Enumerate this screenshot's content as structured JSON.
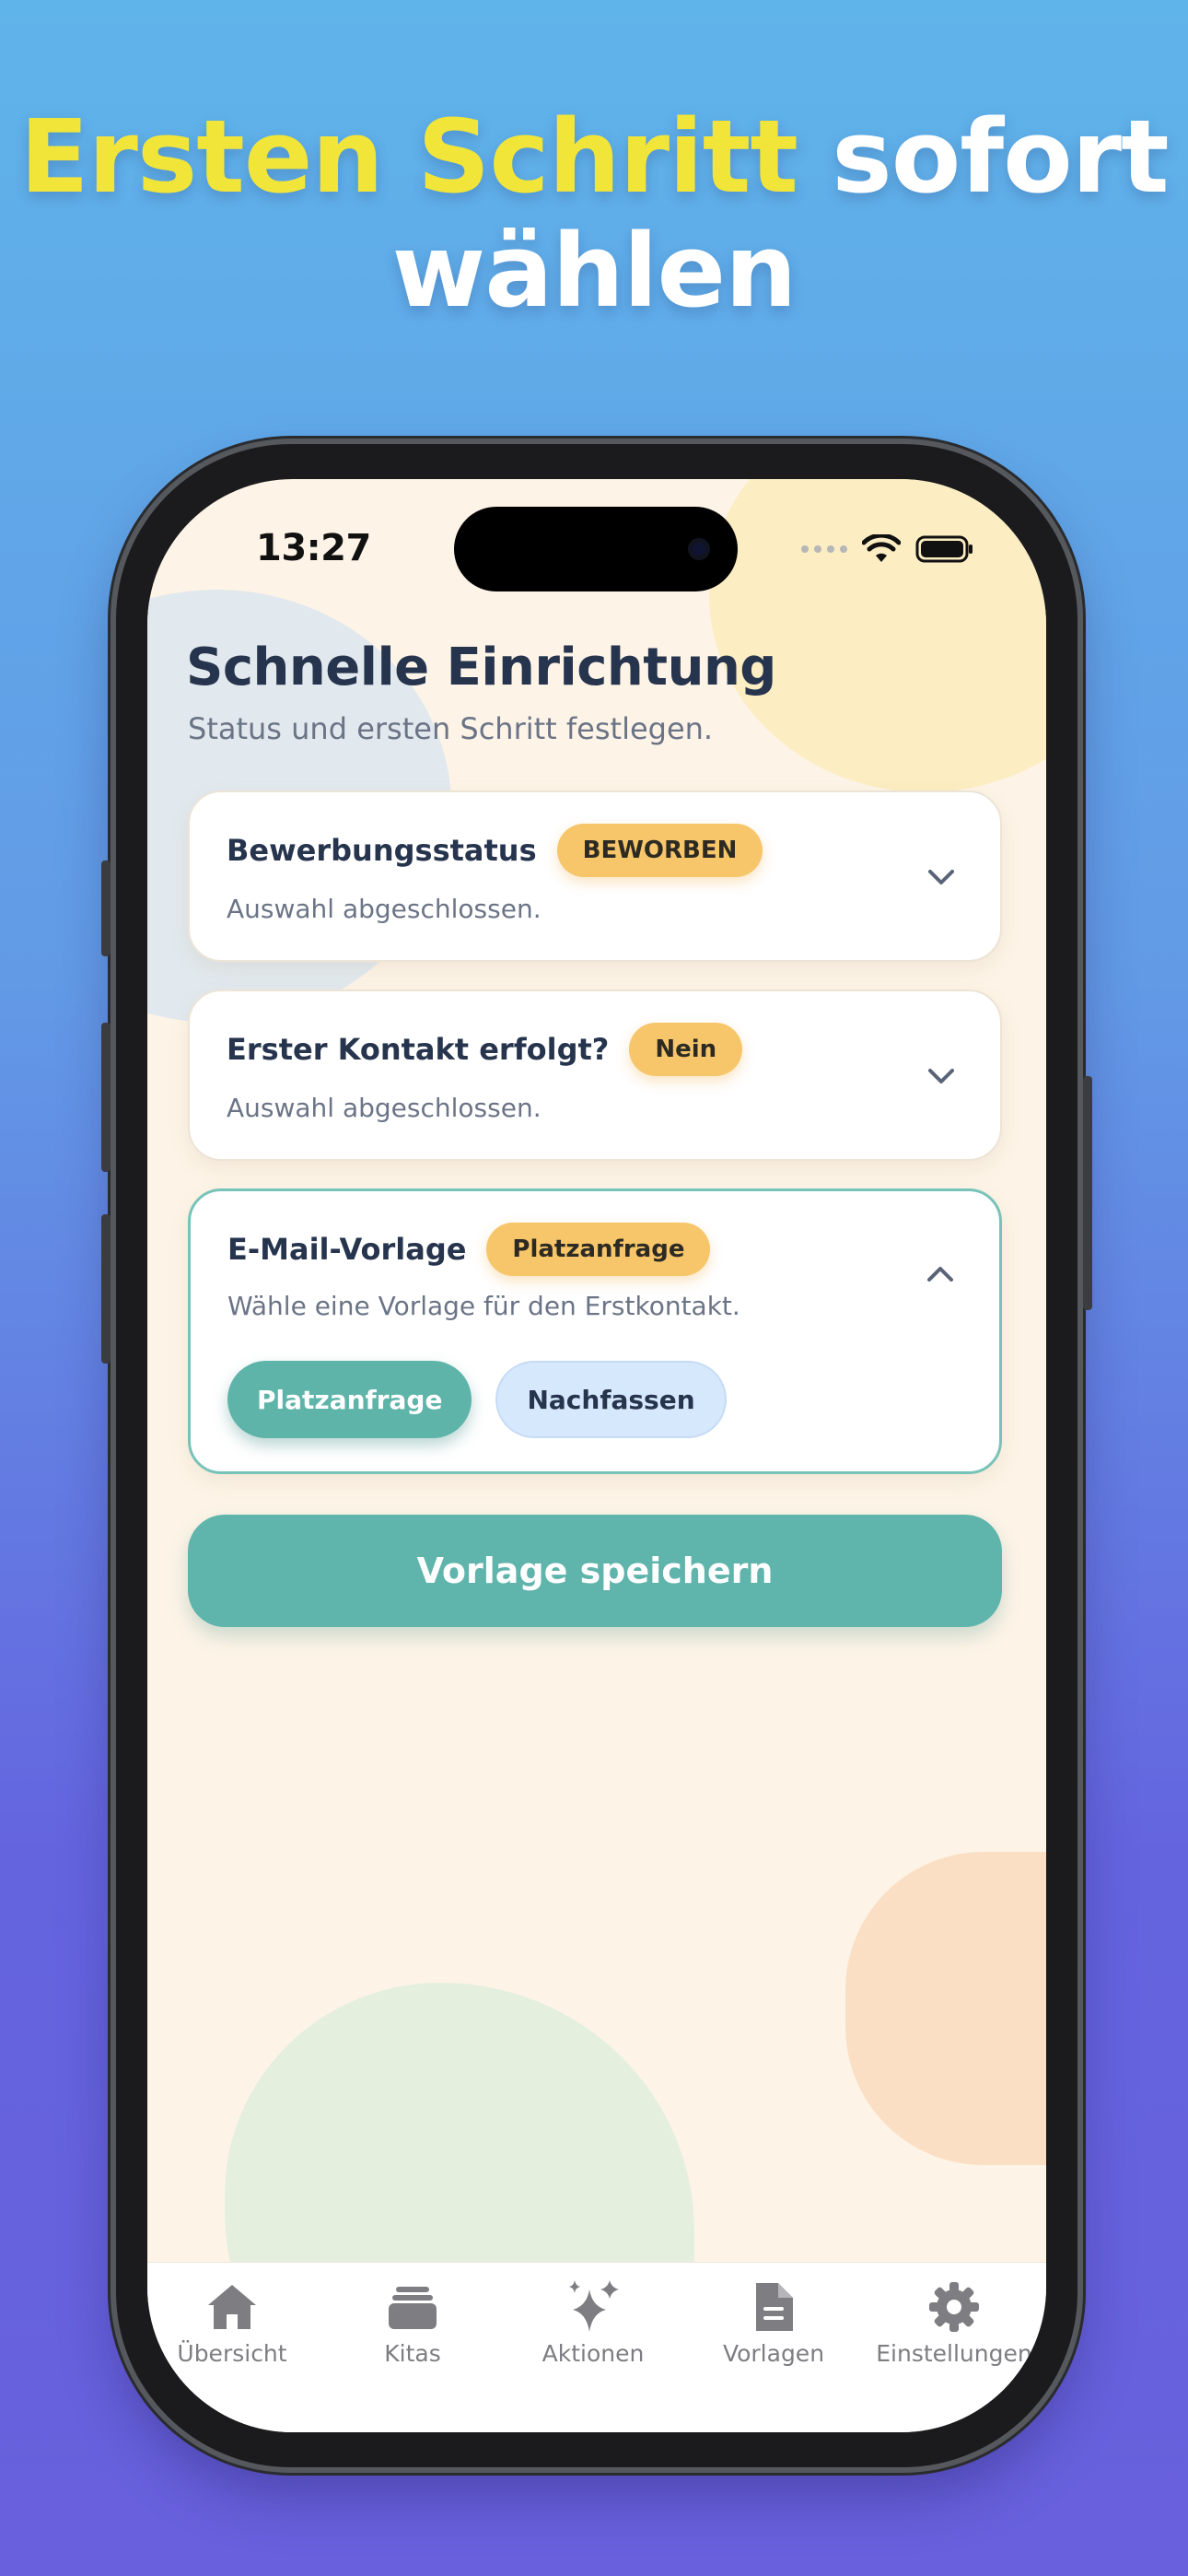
{
  "headline": {
    "highlight": "Ersten Schritt",
    "rest_line1": " sofort",
    "line2": "wählen"
  },
  "status_bar": {
    "time": "13:27"
  },
  "screen": {
    "title": "Schnelle Einrichtung",
    "subtitle": "Status und ersten Schritt festlegen."
  },
  "cards": [
    {
      "title": "Bewerbungsstatus",
      "badge": "BEWORBEN",
      "description": "Auswahl abgeschlossen.",
      "expanded": false
    },
    {
      "title": "Erster Kontakt erfolgt?",
      "badge": "Nein",
      "description": "Auswahl abgeschlossen.",
      "expanded": false
    },
    {
      "title": "E-Mail-Vorlage",
      "badge": "Platzanfrage",
      "description": "Wähle eine Vorlage für den Erstkontakt.",
      "expanded": true,
      "options": [
        {
          "label": "Platzanfrage",
          "selected": true
        },
        {
          "label": "Nachfassen",
          "selected": false
        }
      ]
    }
  ],
  "save_button": {
    "label": "Vorlage speichern"
  },
  "tabbar": [
    {
      "label": "Übersicht",
      "icon": "house-icon"
    },
    {
      "label": "Kitas",
      "icon": "stack-icon"
    },
    {
      "label": "Aktionen",
      "icon": "sparkles-icon"
    },
    {
      "label": "Vorlagen",
      "icon": "document-icon"
    },
    {
      "label": "Einstellungen",
      "icon": "gear-icon"
    }
  ],
  "colors": {
    "headline_highlight": "#f1e53a",
    "accent_teal": "#5fb4ab",
    "badge_yellow": "#f7c66a",
    "option_unselected": "#d6e8fb",
    "text_dark": "#26344d",
    "background_cream": "#fdf4e7"
  }
}
